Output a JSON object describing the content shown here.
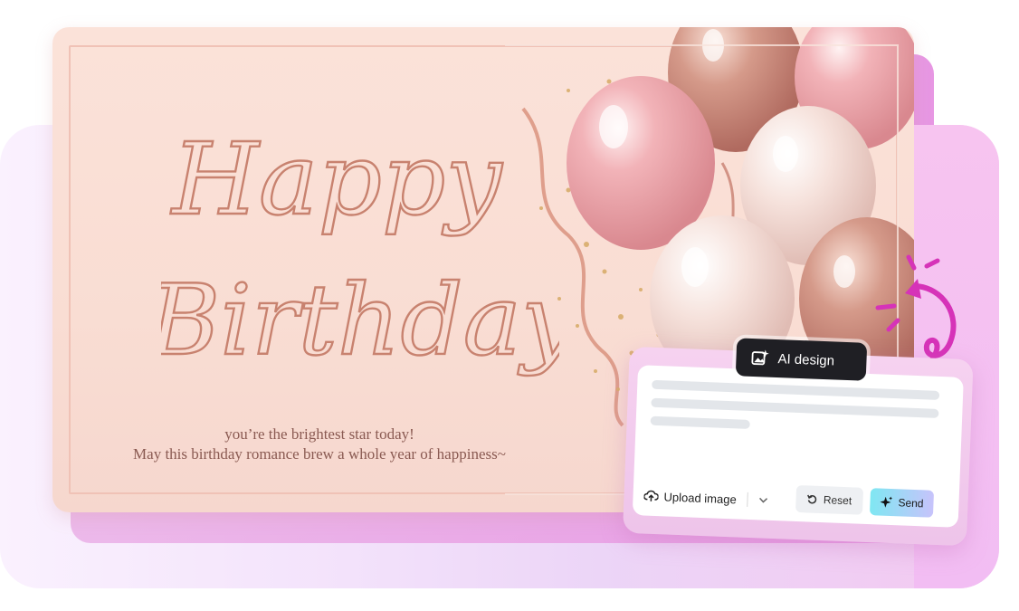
{
  "card": {
    "title_line1": "Happy",
    "title_line2": "Birthday",
    "message_line1": "you’re the brightest star today!",
    "message_line2": "May this birthday romance brew a whole year of happiness~"
  },
  "ai_panel": {
    "badge_label": "AI design",
    "upload_label": "Upload image",
    "reset_label": "Reset",
    "send_label": "Send",
    "icons": {
      "badge": "image-sparkle-icon",
      "upload": "cloud-upload-icon",
      "dropdown": "chevron-down-icon",
      "reset": "reset-icon",
      "send": "sparkle-icon"
    }
  },
  "colors": {
    "title_stroke": "#c8826f",
    "send_gradient_start": "#7fe7f2",
    "send_gradient_end": "#c7c3fb",
    "arrow": "#d633b8"
  }
}
